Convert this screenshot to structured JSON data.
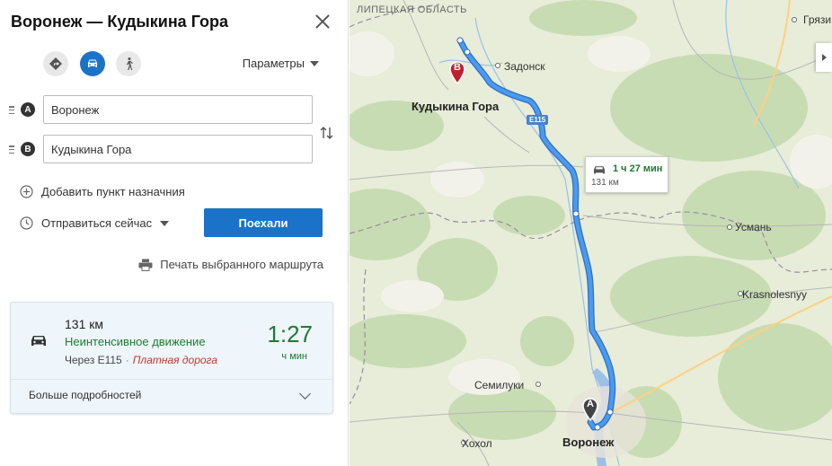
{
  "panel": {
    "title": "Воронеж — Кудыкина Гора",
    "modes": [
      {
        "name": "directions-icon",
        "active": false
      },
      {
        "name": "car-icon",
        "active": true
      },
      {
        "name": "walk-icon",
        "active": false
      }
    ],
    "params_label": "Параметры",
    "from": {
      "letter": "A",
      "value": "Воронеж"
    },
    "to": {
      "letter": "B",
      "value": "Кудыкина Гора"
    },
    "add_destination": "Добавить пункт назначния",
    "depart_label": "Отправиться сейчас",
    "go_button": "Поехали",
    "print_label": "Печать выбранного маршрута",
    "route": {
      "distance": "131 км",
      "traffic": "Неинтенсивное движение",
      "via": "Через E115",
      "separator": "·",
      "toll": "Платная дорога",
      "time": "1:27",
      "time_unit": "ч мин",
      "more": "Больше подробностей"
    }
  },
  "map": {
    "labels": {
      "region": "ЛИПЕЦКАЯ ОБЛАСТЬ",
      "gryazi": "Грязи",
      "zadonsk": "Задонск",
      "kudykina": "Кудыкина Гора",
      "usman": "Усмань",
      "krasnolesny": "Krasnolesnyy",
      "semiluki": "Семилуки",
      "khokhol": "Хохол",
      "voronezh": "Воронеж"
    },
    "road_sign": "E115",
    "bubble": {
      "time": "1 ч 27 мин",
      "distance": "131 км"
    },
    "marker_a": "A",
    "marker_b": "B",
    "colors": {
      "route": "#3f8ae0",
      "forest": "#c8dcb3",
      "land": "#e7edd8",
      "water": "#9cc0e8",
      "accent": "#1a73c8",
      "green_text": "#1f7a33",
      "toll_text": "#c0392b",
      "marker_b": "#c0202e"
    }
  }
}
